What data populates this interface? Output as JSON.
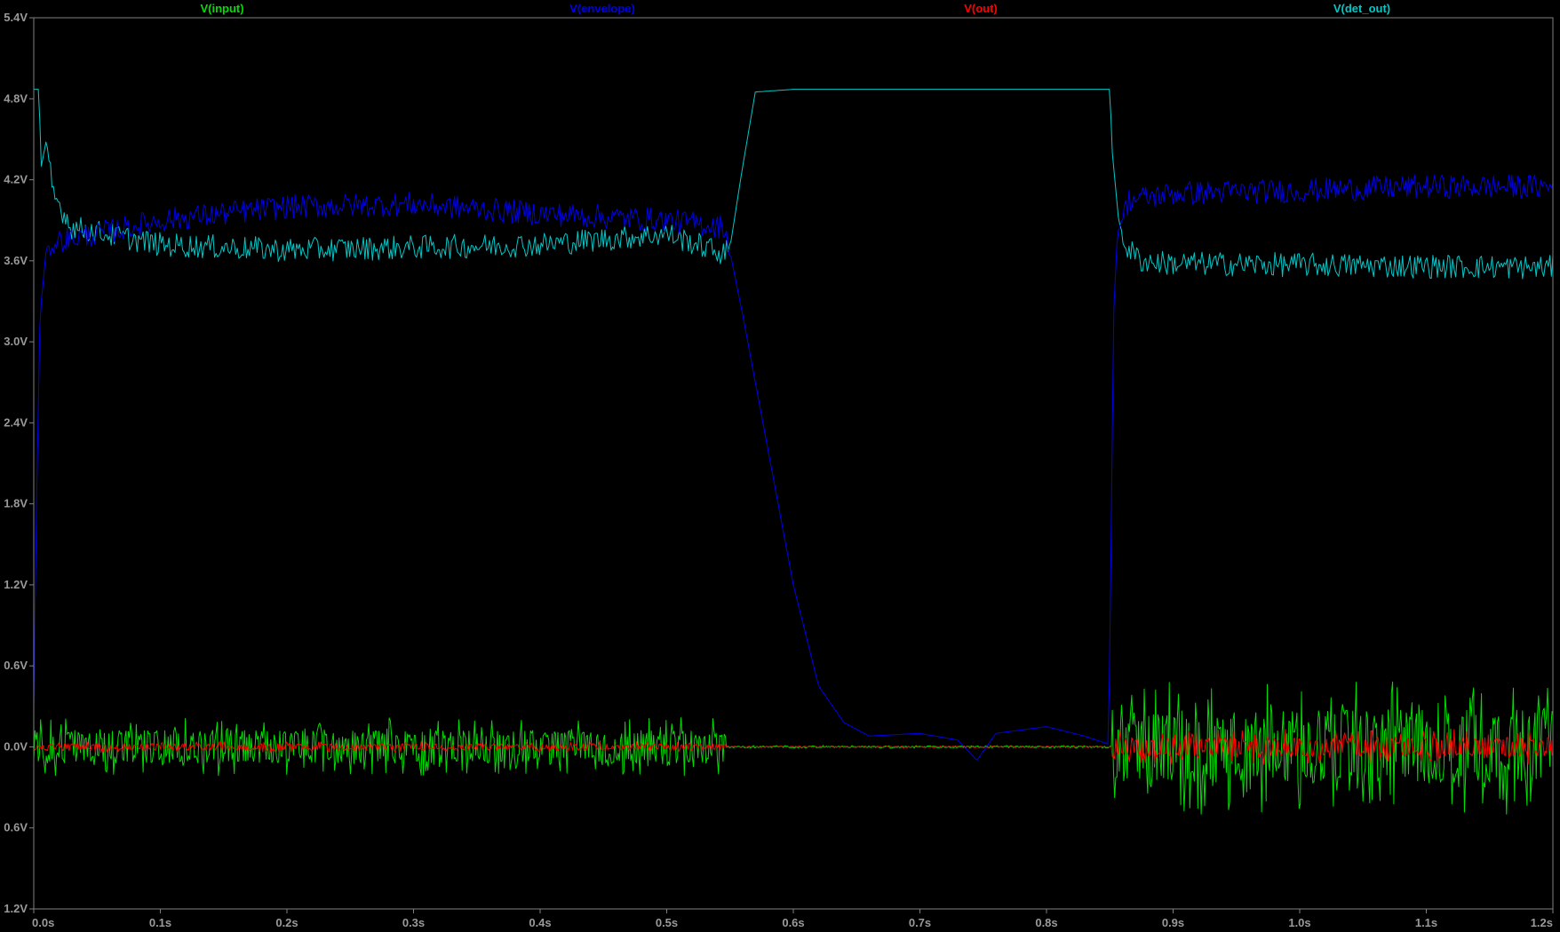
{
  "chart_data": {
    "type": "line",
    "background": "#000000",
    "xlim": [
      0.0,
      1.2
    ],
    "ylim": [
      -1.2,
      5.4
    ],
    "x_ticks": [
      "0.0s",
      "0.1s",
      "0.2s",
      "0.3s",
      "0.4s",
      "0.5s",
      "0.6s",
      "0.7s",
      "0.8s",
      "0.9s",
      "1.0s",
      "1.1s",
      "1.2s"
    ],
    "y_ticks": [
      "5.4V",
      "4.8V",
      "4.2V",
      "3.6V",
      "3.0V",
      "2.4V",
      "1.8V",
      "1.2V",
      "0.6V",
      "0.0V",
      "0.6V",
      "1.2V"
    ],
    "y_tick_values": [
      5.4,
      4.8,
      4.2,
      3.6,
      3.0,
      2.4,
      1.8,
      1.2,
      0.6,
      0.0,
      -0.6,
      -1.2
    ],
    "grid": false,
    "series": [
      {
        "name": "V(input)",
        "color": "#00dd00",
        "description": "noisy signal around 0 V",
        "segments": [
          {
            "x": [
              0.0,
              0.547
            ],
            "center": 0.0,
            "amplitude": 0.22
          },
          {
            "x": [
              0.547,
              0.852
            ],
            "center": 0.0,
            "amplitude": 0.01
          },
          {
            "x": [
              0.852,
              1.2
            ],
            "center": 0.0,
            "amplitude": 0.5
          }
        ]
      },
      {
        "name": "V(envelope)",
        "color": "#0000ee",
        "points": [
          [
            0.0,
            0.3
          ],
          [
            0.002,
            1.7
          ],
          [
            0.005,
            3.2
          ],
          [
            0.01,
            3.7
          ],
          [
            0.02,
            3.75
          ],
          [
            0.05,
            3.8
          ],
          [
            0.1,
            3.9
          ],
          [
            0.2,
            4.0
          ],
          [
            0.3,
            4.02
          ],
          [
            0.4,
            3.95
          ],
          [
            0.5,
            3.9
          ],
          [
            0.546,
            3.85
          ],
          [
            0.56,
            3.2
          ],
          [
            0.58,
            2.2
          ],
          [
            0.6,
            1.2
          ],
          [
            0.62,
            0.45
          ],
          [
            0.64,
            0.18
          ],
          [
            0.66,
            0.08
          ],
          [
            0.7,
            0.1
          ],
          [
            0.73,
            0.05
          ],
          [
            0.745,
            -0.1
          ],
          [
            0.76,
            0.1
          ],
          [
            0.8,
            0.15
          ],
          [
            0.83,
            0.08
          ],
          [
            0.849,
            0.02
          ],
          [
            0.851,
            1.5
          ],
          [
            0.853,
            3.2
          ],
          [
            0.856,
            3.8
          ],
          [
            0.865,
            4.05
          ],
          [
            0.9,
            4.1
          ],
          [
            1.0,
            4.12
          ],
          [
            1.1,
            4.15
          ],
          [
            1.2,
            4.15
          ]
        ],
        "noise_until": 0.55,
        "noise_after": 0.86,
        "noise_amplitude": 0.09
      },
      {
        "name": "V(out)",
        "color": "#ff0000",
        "description": "small noise around 0 V",
        "segments": [
          {
            "x": [
              0.0,
              0.547
            ],
            "center": 0.0,
            "amplitude": 0.04
          },
          {
            "x": [
              0.547,
              0.852
            ],
            "center": 0.0,
            "amplitude": 0.006
          },
          {
            "x": [
              0.852,
              1.2
            ],
            "center": 0.0,
            "amplitude": 0.13
          }
        ]
      },
      {
        "name": "V(det_out)",
        "color": "#00c8c8",
        "points": [
          [
            0.0,
            4.87
          ],
          [
            0.004,
            4.87
          ],
          [
            0.006,
            4.3
          ],
          [
            0.01,
            4.5
          ],
          [
            0.015,
            4.1
          ],
          [
            0.03,
            3.85
          ],
          [
            0.1,
            3.72
          ],
          [
            0.2,
            3.68
          ],
          [
            0.3,
            3.7
          ],
          [
            0.4,
            3.72
          ],
          [
            0.5,
            3.8
          ],
          [
            0.546,
            3.65
          ],
          [
            0.55,
            3.7
          ],
          [
            0.56,
            4.3
          ],
          [
            0.57,
            4.85
          ],
          [
            0.6,
            4.87
          ],
          [
            0.7,
            4.87
          ],
          [
            0.8,
            4.87
          ],
          [
            0.85,
            4.87
          ],
          [
            0.852,
            4.4
          ],
          [
            0.857,
            3.9
          ],
          [
            0.863,
            3.7
          ],
          [
            0.875,
            3.6
          ],
          [
            0.9,
            3.58
          ],
          [
            1.0,
            3.57
          ],
          [
            1.1,
            3.56
          ],
          [
            1.2,
            3.55
          ]
        ],
        "noise_until": 0.55,
        "noise_after": 0.86,
        "noise_amplitude": 0.09
      }
    ]
  }
}
